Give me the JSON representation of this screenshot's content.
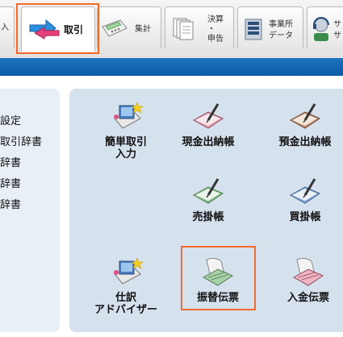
{
  "tabs": {
    "partial_left": "入",
    "torihiki": "取引",
    "shukei": "集計",
    "kessan_line1": "決算",
    "kessan_dot": "・",
    "kessan_line2": "申告",
    "jigyosho_line1": "事業所",
    "jigyosho_line2": "データ",
    "partial_right1": "サ",
    "partial_right2": "サ"
  },
  "sidebar": {
    "items": [
      {
        "label": "設定"
      },
      {
        "label": "取引辞書"
      },
      {
        "label": "辞書"
      },
      {
        "label": "辞書"
      },
      {
        "label": "辞書"
      }
    ]
  },
  "functions": {
    "kantan_line1": "簡単取引",
    "kantan_line2": "入力",
    "genkin": "現金出納帳",
    "yokin": "預金出納帳",
    "urikake": "売掛帳",
    "kaikake": "買掛帳",
    "shiwake_line1": "仕訳",
    "shiwake_line2": "アドバイザー",
    "furikae": "振替伝票",
    "nyukin": "入金伝票"
  },
  "colors": {
    "highlight": "#f26b2a",
    "bluebar": "#0b5aa6",
    "panel": "#d6e1ee",
    "sidebar": "#e9eff7"
  }
}
